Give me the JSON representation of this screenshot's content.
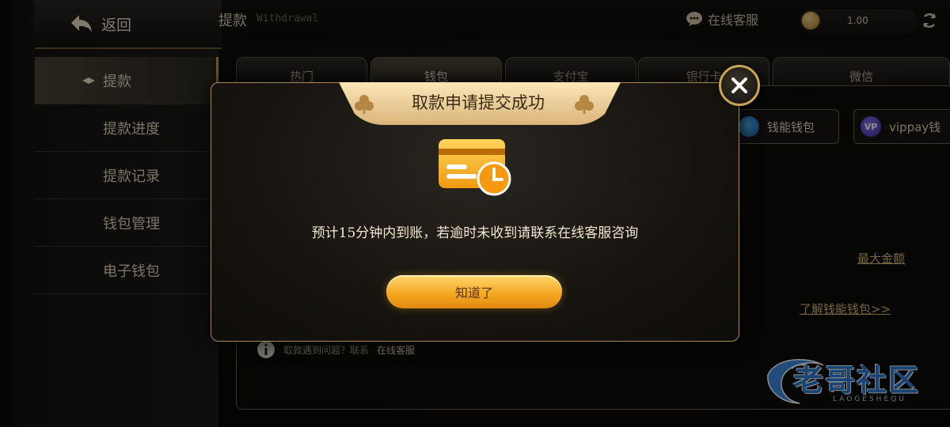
{
  "header": {
    "back_label": "返回",
    "title": "提款",
    "subtitle": "Withdrawal",
    "service_label": "在线客服",
    "balance": "1.00"
  },
  "sidebar": {
    "items": [
      {
        "label": "提款",
        "active": true
      },
      {
        "label": "提款进度"
      },
      {
        "label": "提款记录"
      },
      {
        "label": "钱包管理"
      },
      {
        "label": "电子钱包"
      }
    ]
  },
  "tabs": [
    "热门",
    "钱包",
    "支付宝",
    "银行卡",
    "微信"
  ],
  "wallet_options": [
    {
      "label": "钱能钱包",
      "icon": "wallet-globe-icon"
    },
    {
      "label": "vippay钱",
      "icon": "vp-icon"
    }
  ],
  "main": {
    "max_amount_link": "最大金额",
    "learn_more_link": "了解钱能钱包>>",
    "help_text": "取款遇到问题？联系",
    "help_link": "在线客服"
  },
  "modal": {
    "title": "取款申请提交成功",
    "message": "预计15分钟内到账，若逾时未收到请联系在线客服咨询",
    "ok_label": "知道了",
    "icon": "card-clock-icon"
  },
  "watermark": {
    "text": "老哥社区",
    "sub": "LAOGESHEQU"
  },
  "colors": {
    "accent_gold": "#c49b4a",
    "button_orange": "#f3a620",
    "link_gold": "#d9b872"
  }
}
